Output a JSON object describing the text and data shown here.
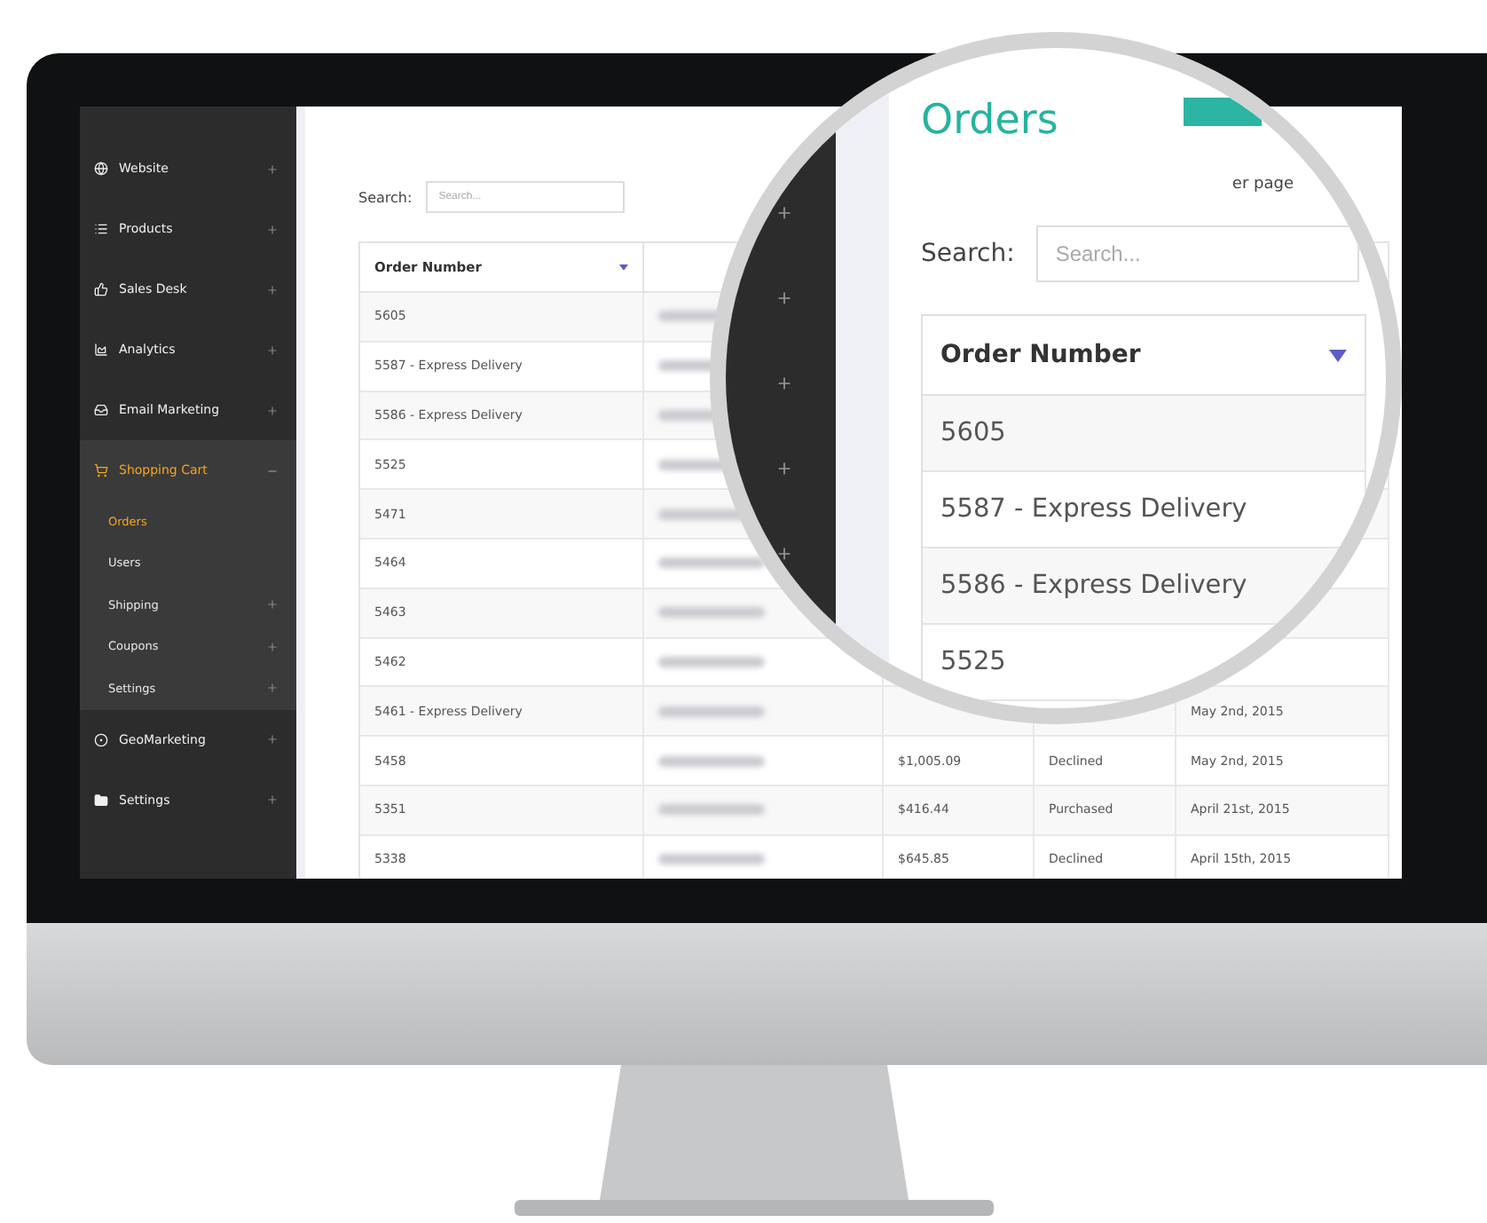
{
  "sidebar": {
    "items": [
      {
        "label": "Website",
        "expandable": true,
        "expanded": false,
        "selected": false
      },
      {
        "label": "Products",
        "expandable": true,
        "expanded": false,
        "selected": false
      },
      {
        "label": "Sales Desk",
        "expandable": true,
        "expanded": false,
        "selected": false
      },
      {
        "label": "Analytics",
        "expandable": true,
        "expanded": false,
        "selected": false
      },
      {
        "label": "Email Marketing",
        "expandable": true,
        "expanded": false,
        "selected": false
      },
      {
        "label": "Shopping Cart",
        "expandable": true,
        "expanded": true,
        "selected": true,
        "children": [
          {
            "label": "Orders",
            "expandable": false,
            "selected": true
          },
          {
            "label": "Users",
            "expandable": false,
            "selected": false
          },
          {
            "label": "Shipping",
            "expandable": true,
            "selected": false
          },
          {
            "label": "Coupons",
            "expandable": true,
            "selected": false
          },
          {
            "label": "Settings",
            "expandable": true,
            "selected": false
          }
        ]
      },
      {
        "label": "GeoMarketing",
        "expandable": true,
        "expanded": false,
        "selected": false
      },
      {
        "label": "Settings",
        "expandable": true,
        "expanded": false,
        "selected": false
      }
    ]
  },
  "search": {
    "label": "Search:",
    "placeholder": "Search..."
  },
  "table": {
    "columns": [
      "Order Number"
    ],
    "rows": [
      {
        "order": "5605"
      },
      {
        "order": "5587 - Express Delivery"
      },
      {
        "order": "5586 - Express Delivery"
      },
      {
        "order": "5525"
      },
      {
        "order": "5471"
      },
      {
        "order": "5464"
      },
      {
        "order": "5463"
      },
      {
        "order": "5462"
      },
      {
        "order": "5461 - Express Delivery",
        "date": "May 2nd, 2015"
      },
      {
        "order": "5458",
        "total": "$1,005.09",
        "status": "Declined",
        "date": "May 2nd, 2015"
      },
      {
        "order": "5351",
        "total": "$416.44",
        "status": "Purchased",
        "date": "April 21st, 2015"
      },
      {
        "order": "5338",
        "total": "$645.85",
        "status": "Declined",
        "date": "April 15th, 2015"
      }
    ]
  },
  "magnifier": {
    "title": "Orders",
    "per_page_text": "er page",
    "search": {
      "label": "Search:",
      "placeholder": "Search..."
    },
    "table": {
      "column": "Order Number",
      "rows": [
        "5605",
        "5587 - Express Delivery",
        "5586 - Express Delivery",
        "5525"
      ]
    }
  }
}
